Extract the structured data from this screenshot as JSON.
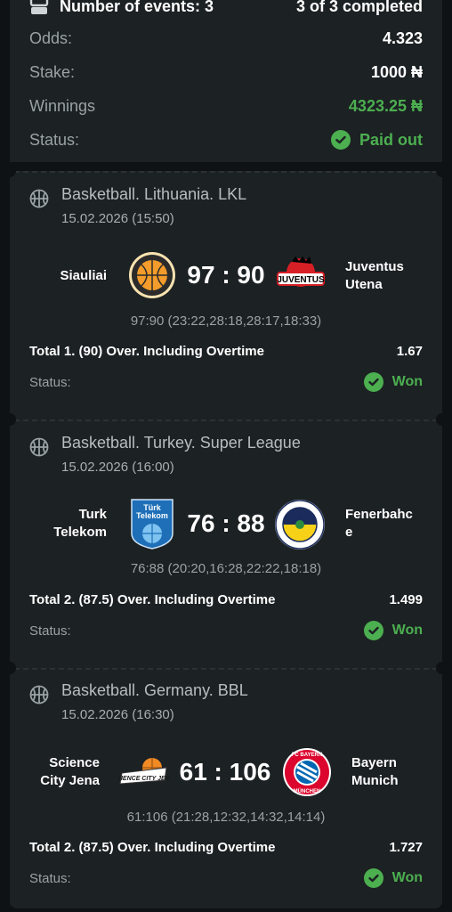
{
  "summary": {
    "events_label": "Number of events: 3",
    "completed": "3 of 3 completed",
    "odds_label": "Odds:",
    "odds_value": "4.323",
    "stake_label": "Stake:",
    "stake_value": "1000 ₦",
    "winnings_label": "Winnings",
    "winnings_value": "4323.25 ₦",
    "status_label": "Status:",
    "status_value": "Paid out"
  },
  "events": [
    {
      "league": "Basketball. Lithuania. LKL",
      "date": "15.02.2026 (15:50)",
      "home": "Siauliai",
      "away_line1": "Juventus",
      "away_line2": "Utena",
      "score": "97 : 90",
      "periods": "97:90 (23:22,28:18,28:17,18:33)",
      "bet": "Total 1. (90) Over. Including Overtime",
      "odds": "1.67",
      "status_label": "Status:",
      "status": "Won"
    },
    {
      "league": "Basketball. Turkey. Super League",
      "date": "15.02.2026 (16:00)",
      "home_line1": "Turk",
      "home_line2": "Telekom",
      "away_line1": "Fenerbahc",
      "away_line2": "e",
      "score": "76 : 88",
      "periods": "76:88 (20:20,16:28,22:22,18:18)",
      "bet": "Total 2. (87.5) Over. Including Overtime",
      "odds": "1.499",
      "status_label": "Status:",
      "status": "Won"
    },
    {
      "league": "Basketball. Germany. BBL",
      "date": "15.02.2026 (16:30)",
      "home_line1": "Science",
      "home_line2": "City Jena",
      "away_line1": "Bayern",
      "away_line2": "Munich",
      "score": "61 : 106",
      "periods": "61:106 (21:28,12:32,14:32,14:14)",
      "bet": "Total 2. (87.5) Over. Including Overtime",
      "odds": "1.727",
      "status_label": "Status:",
      "status": "Won"
    }
  ],
  "colors": {
    "background": "#0f1214",
    "card": "#1c2123",
    "accent_green": "#4caf50",
    "muted": "#9aa2a6"
  },
  "icons": [
    "coupon-icon",
    "check-circle-icon",
    "basketball-icon"
  ]
}
